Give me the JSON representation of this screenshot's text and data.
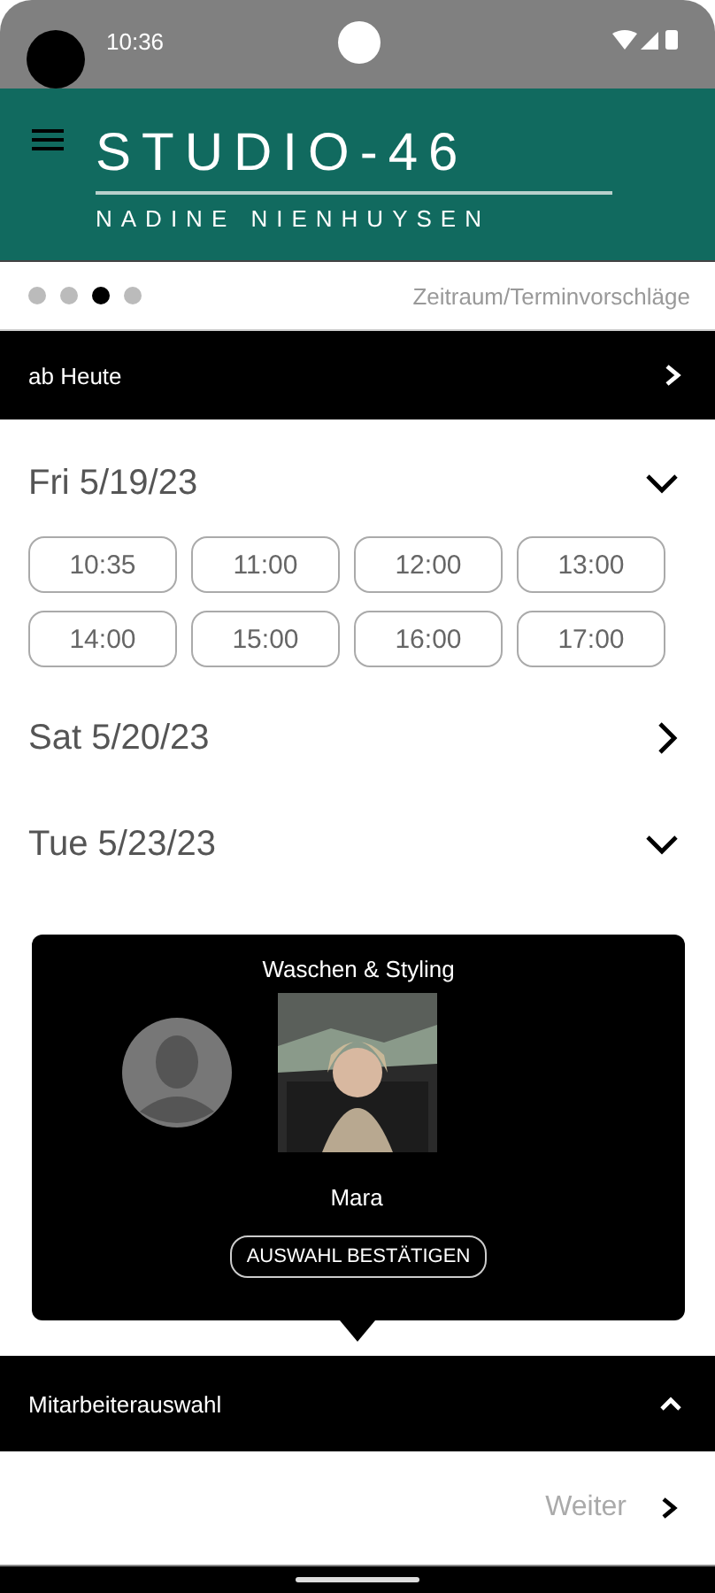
{
  "status_bar": {
    "time": "10:36"
  },
  "header": {
    "logo_title": "STUDIO-46",
    "logo_subtitle": "NADINE NIENHUYSEN"
  },
  "steps": [
    {
      "selected": false
    },
    {
      "selected": false
    },
    {
      "selected": true
    },
    {
      "selected": false
    }
  ],
  "step_title": "Zeitraum/Terminvorschläge",
  "filter": {
    "label": "ab Heute"
  },
  "days": [
    {
      "label": "Fri 5/19/23",
      "expanded": true,
      "slots": [
        "10:35",
        "11:00",
        "12:00",
        "13:00",
        "14:00",
        "15:00",
        "16:00",
        "17:00"
      ]
    },
    {
      "label": "Sat 5/20/23",
      "expanded": false
    },
    {
      "label": "Tue 5/23/23",
      "expanded": true
    }
  ],
  "popup": {
    "title": "Waschen & Styling",
    "employees": [
      {
        "kind": "avatar"
      },
      {
        "kind": "picture",
        "name": "Mara"
      }
    ],
    "button": "AUSWAHL BESTÄTIGEN"
  },
  "section": {
    "label": "Mitarbeiterauswahl",
    "expanded": true
  },
  "next": {
    "label": "Weiter"
  }
}
